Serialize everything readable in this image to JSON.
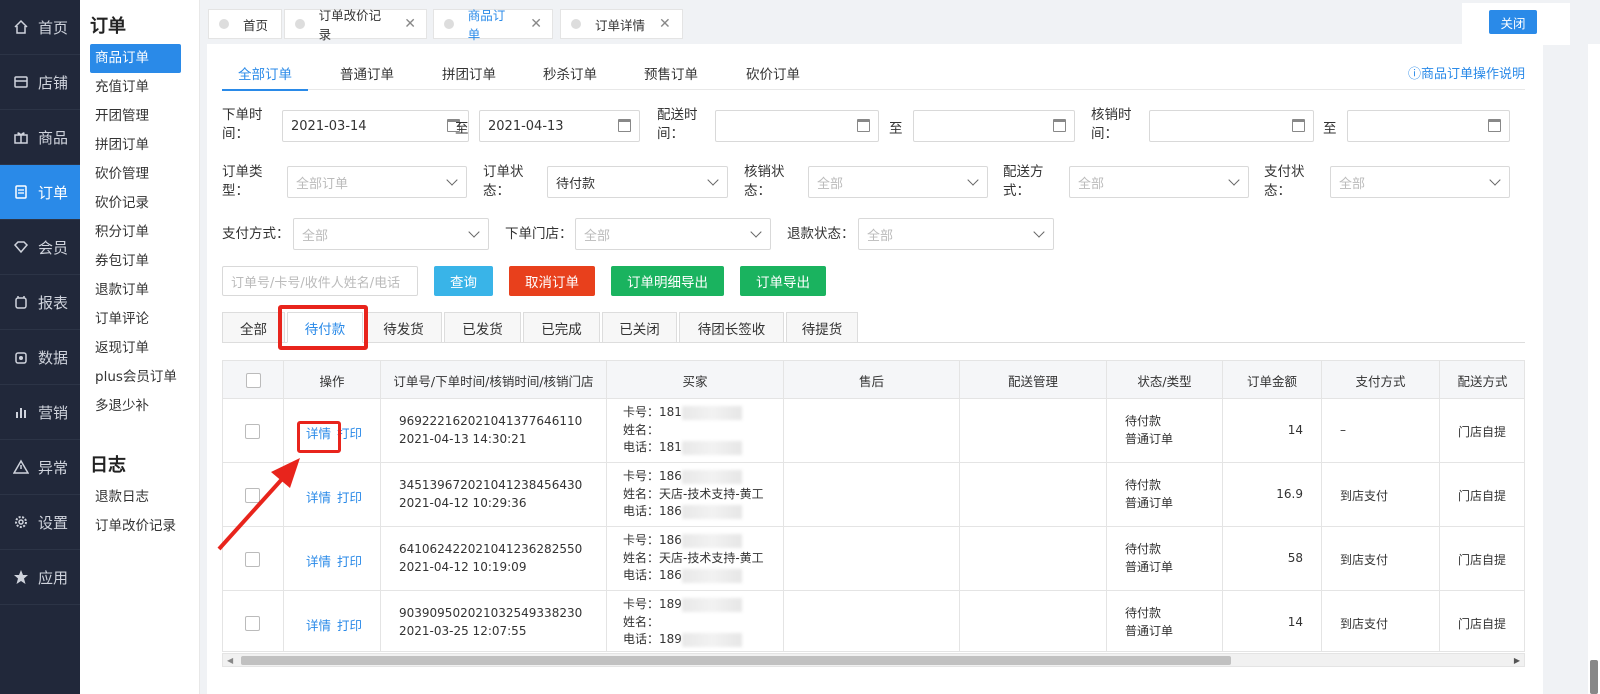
{
  "nav": {
    "items": [
      {
        "label": "首页",
        "icon": "home-icon"
      },
      {
        "label": "店铺",
        "icon": "store-icon"
      },
      {
        "label": "商品",
        "icon": "gift-icon"
      },
      {
        "label": "订单",
        "icon": "order-icon",
        "active": true
      },
      {
        "label": "会员",
        "icon": "diamond-icon"
      },
      {
        "label": "报表",
        "icon": "report-icon"
      },
      {
        "label": "数据",
        "icon": "data-icon"
      },
      {
        "label": "营销",
        "icon": "bar-chart-icon"
      },
      {
        "label": "异常",
        "icon": "warning-icon"
      },
      {
        "label": "设置",
        "icon": "gear-icon"
      },
      {
        "label": "应用",
        "icon": "star-icon"
      }
    ]
  },
  "subnav": {
    "title": "订单",
    "items": [
      "商品订单",
      "充值订单",
      "开团管理",
      "拼团订单",
      "砍价管理",
      "砍价记录",
      "积分订单",
      "券包订单",
      "退款订单",
      "订单评论",
      "返现订单",
      "plus会员订单",
      "多退少补"
    ],
    "log_title": "日志",
    "log_items": [
      "退款日志",
      "订单改价记录"
    ]
  },
  "top_tabs": [
    {
      "label": "首页",
      "closable": false
    },
    {
      "label": "订单改价记录",
      "closable": true
    },
    {
      "label": "商品订单",
      "closable": true,
      "active": true
    },
    {
      "label": "订单详情",
      "closable": true
    }
  ],
  "close_label": "关闭",
  "order_tabs": [
    "全部订单",
    "普通订单",
    "拼团订单",
    "秒杀订单",
    "预售订单",
    "砍价订单"
  ],
  "help_link": "商品订单操作说明",
  "filters": {
    "order_time_label": "下单时间：",
    "order_time_from": "2021-03-14",
    "order_time_to": "2021-04-13",
    "to_label": "至",
    "delivery_time_label": "配送时间：",
    "verify_time_label": "核销时间：",
    "order_type_label": "订单类型：",
    "order_type_value": "全部订单",
    "order_status_label": "订单状态：",
    "order_status_value": "待付款",
    "verify_status_label": "核销状态：",
    "delivery_method_label": "配送方式：",
    "pay_status_label": "支付状态：",
    "pay_method_label": "支付方式：",
    "store_label": "下单门店：",
    "refund_status_label": "退款状态：",
    "all_placeholder": "全部",
    "search_placeholder": "订单号/卡号/收件人姓名/电话"
  },
  "buttons": {
    "query": "查询",
    "cancel_order": "取消订单",
    "export_detail": "订单明细导出",
    "export_order": "订单导出"
  },
  "colors": {
    "primary": "#2a8ae8",
    "info": "#39b4e8",
    "danger": "#e8401c",
    "success": "#1ab35f",
    "nav_bg": "#21283a",
    "highlight": "#e8241c"
  },
  "status_tabs": [
    "全部",
    "待付款",
    "待发货",
    "已发货",
    "已完成",
    "已关闭",
    "待团长签收",
    "待提货"
  ],
  "active_status_tab": "待付款",
  "table": {
    "headers": [
      "操作",
      "订单号/下单时间/核销时间/核销门店",
      "买家",
      "售后",
      "配送管理",
      "状态/类型",
      "订单金额",
      "支付方式",
      "配送方式"
    ],
    "action_detail": "详情",
    "action_print": "打印",
    "rows": [
      {
        "order_no": "96922216202104137764611 0",
        "time": "2021-04-13 14:30:21",
        "card": "卡号：181",
        "name": "姓名：",
        "phone": "电话：181",
        "status": "待付款",
        "type": "普通订单",
        "amount": "14",
        "pay": "–",
        "delivery": "门店自提"
      },
      {
        "order_no": "34513967202104123845643 0",
        "time": "2021-04-12 10:29:36",
        "card": "卡号：186",
        "name": "姓名：天店-技术支持-黄工",
        "phone": "电话：186",
        "status": "待付款",
        "type": "普通订单",
        "amount": "16.9",
        "pay": "到店支付",
        "delivery": "门店自提"
      },
      {
        "order_no": "64106242202104123628255 0",
        "time": "2021-04-12 10:19:09",
        "card": "卡号：186",
        "name": "姓名：天店-技术支持-黄工",
        "phone": "电话：186",
        "status": "待付款",
        "type": "普通订单",
        "amount": "58",
        "pay": "到店支付",
        "delivery": "门店自提"
      },
      {
        "order_no": "90390950202103254933823 0",
        "time": "2021-03-25 12:07:55",
        "card": "卡号：189",
        "name": "姓名：",
        "phone": "电话：189",
        "status": "待付款",
        "type": "普通订单",
        "amount": "14",
        "pay": "到店支付",
        "delivery": "门店自提"
      }
    ]
  }
}
